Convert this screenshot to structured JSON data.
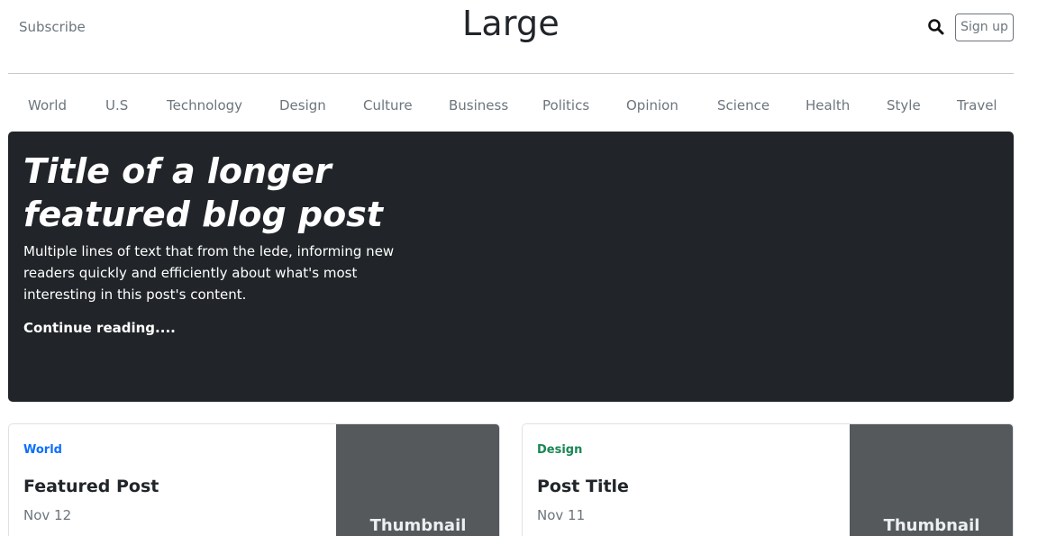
{
  "header": {
    "subscribe_label": "Subscribe",
    "brand": "Large",
    "search_icon": "search-icon",
    "signup_label": "Sign up"
  },
  "nav": {
    "items": [
      "World",
      "U.S",
      "Technology",
      "Design",
      "Culture",
      "Business",
      "Politics",
      "Opinion",
      "Science",
      "Health",
      "Style",
      "Travel"
    ]
  },
  "hero": {
    "title": "Title of a longer featured blog post",
    "lede": "Multiple lines of text that from the lede, informing new readers quickly and efficiently about what's most interesting in this post's content.",
    "link_label": "Continue reading....",
    "background_color": "#212529"
  },
  "cards": [
    {
      "category": "World",
      "category_color": "#0d6efd",
      "title": "Featured Post",
      "date": "Nov 12",
      "thumbnail_label": "Thumbnail"
    },
    {
      "category": "Design",
      "category_color": "#198754",
      "title": "Post Title",
      "date": "Nov 11",
      "thumbnail_label": "Thumbnail"
    }
  ]
}
